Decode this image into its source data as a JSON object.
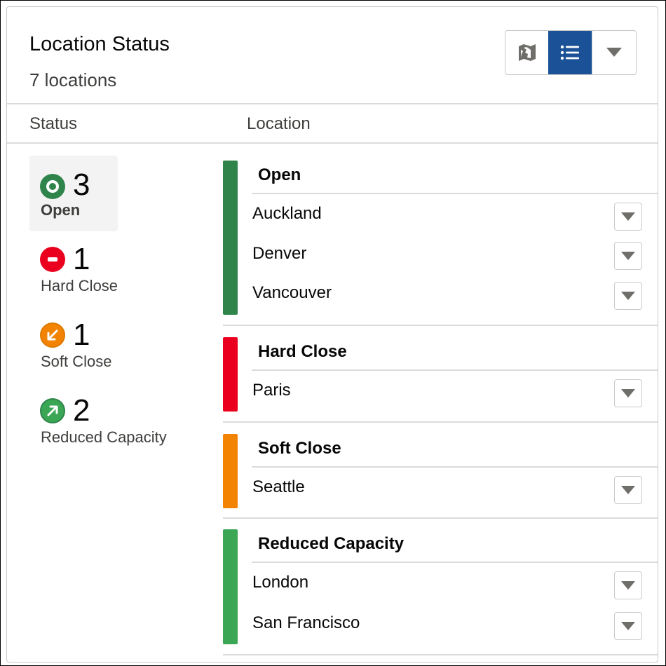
{
  "header": {
    "title": "Location Status",
    "count": "7 locations",
    "view_map_icon": "map-icon",
    "view_list_icon": "list-icon",
    "more_icon": "chevron-down-icon"
  },
  "columns": {
    "status": "Status",
    "location": "Location"
  },
  "colors": {
    "open": "#2e844a",
    "hard_close": "#ea001e",
    "soft_close": "#f38303",
    "reduced_capacity": "#3ba755",
    "selected_button": "#1b5297"
  },
  "stats": [
    {
      "label": "Open",
      "count": "3",
      "icon": "circle-dot-icon"
    },
    {
      "label": "Hard Close",
      "count": "1",
      "icon": "minus-circle-icon"
    },
    {
      "label": "Soft Close",
      "count": "1",
      "icon": "arrow-down-left-icon"
    },
    {
      "label": "Reduced Capacity",
      "count": "2",
      "icon": "arrow-up-right-icon"
    }
  ],
  "groups": [
    {
      "title": "Open",
      "locations": [
        "Auckland",
        "Denver",
        "Vancouver"
      ]
    },
    {
      "title": "Hard Close",
      "locations": [
        "Paris"
      ]
    },
    {
      "title": "Soft Close",
      "locations": [
        "Seattle"
      ]
    },
    {
      "title": "Reduced Capacity",
      "locations": [
        "London",
        "San Francisco"
      ]
    }
  ]
}
